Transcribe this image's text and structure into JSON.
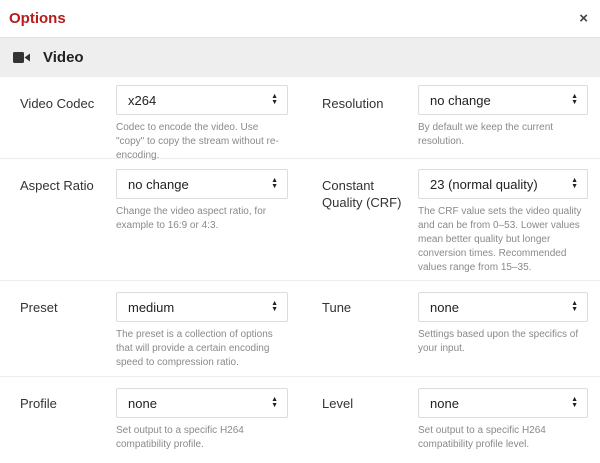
{
  "dialog": {
    "title": "Options",
    "close_label": "×"
  },
  "section": {
    "title": "Video",
    "icon": "video-camera-icon"
  },
  "rows": [
    {
      "left": {
        "label": "Video Codec",
        "value": "x264",
        "help": "Codec to encode the video. Use \"copy\" to copy the stream without re-encoding."
      },
      "right": {
        "label": "Resolution",
        "value": "no change",
        "help": "By default we keep the current resolution."
      }
    },
    {
      "left": {
        "label": "Aspect Ratio",
        "value": "no change",
        "help": "Change the video aspect ratio, for example to 16:9 or 4:3."
      },
      "right": {
        "label": "Constant Quality (CRF)",
        "value": "23 (normal quality)",
        "help": "The CRF value sets the video quality and can be from 0–53. Lower values mean better quality but longer conversion times. Recommended values range from 15–35."
      }
    },
    {
      "left": {
        "label": "Preset",
        "value": "medium",
        "help": "The preset is a collection of options that will provide a certain encoding speed to compression ratio."
      },
      "right": {
        "label": "Tune",
        "value": "none",
        "help": "Settings based upon the specifics of your input."
      }
    },
    {
      "left": {
        "label": "Profile",
        "value": "none",
        "help": "Set output to a specific H264 compatibility profile."
      },
      "right": {
        "label": "Level",
        "value": "none",
        "help": "Set output to a specific H264 compatibility profile level."
      }
    }
  ]
}
